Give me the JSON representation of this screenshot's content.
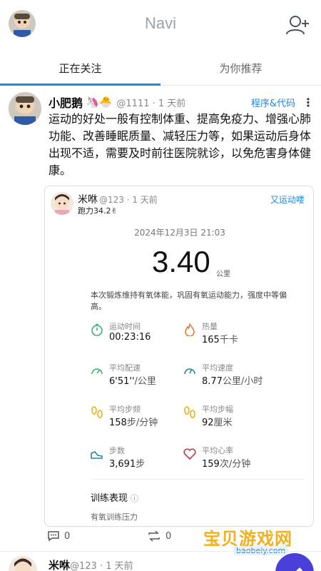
{
  "header": {
    "title": "Navi"
  },
  "tabs": [
    {
      "label": "正在关注",
      "active": true
    },
    {
      "label": "为你推荐",
      "active": false
    }
  ],
  "post": {
    "author": "小肥鹅",
    "emoji": "🦄🐣",
    "handle": "@1111 · 1 天前",
    "tag": "程序&代码",
    "more": "⋮",
    "text": "运动的好处一般有控制体重、提高免疫力、增强心肺功能、改善睡眠质量、减轻压力等，如果运动后身体出现不适，需要及时前往医院就诊，以免危害身体健康。"
  },
  "card": {
    "name": "米咻",
    "handle": "@123 · 1 天前",
    "sub": "跑力34.2✌",
    "tag": "又运动喽",
    "date": "2024年12月3日  21:03",
    "distance": "3.40",
    "unit": "公里",
    "desc": "本次锻炼维持有氧体能，巩固有氧运动能力，强度中等偏高。",
    "metrics": [
      {
        "label": "运动时间",
        "value": "00:23:16",
        "unit": "",
        "icon": "stopwatch-icon"
      },
      {
        "label": "热量",
        "value": "165",
        "unit": "千卡",
        "icon": "flame-icon"
      },
      {
        "label": "平均配速",
        "value": "6'51''",
        "unit": "/公里",
        "icon": "gauge-icon"
      },
      {
        "label": "平均速度",
        "value": "8.77",
        "unit": "公里/小时",
        "icon": "speedometer-icon"
      },
      {
        "label": "平均步频",
        "value": "158",
        "unit": "步/分钟",
        "icon": "footprints-icon"
      },
      {
        "label": "平均步幅",
        "value": "92",
        "unit": "厘米",
        "icon": "footprints-icon"
      },
      {
        "label": "步数",
        "value": "3,691",
        "unit": "步",
        "icon": "shoe-icon"
      },
      {
        "label": "平均心率",
        "value": "159",
        "unit": "次/分钟",
        "icon": "heart-icon"
      }
    ],
    "perf_title": "训练表现",
    "perf_info": "ⓘ",
    "perf_sub": "有氧训练压力"
  },
  "actions": {
    "comments": "0",
    "reposts": "0"
  },
  "watermark": {
    "title": "宝贝游戏网",
    "sub": "baobeiy.com"
  },
  "next_post": {
    "author": "米咻",
    "handle": "@123 · 1 天前"
  },
  "colors": {
    "accent": "#1e88e5",
    "icon_green": "#3cb371",
    "icon_orange": "#e07a3a",
    "icon_yellow": "#e8b11c",
    "icon_teal": "#2a8a8a",
    "icon_red": "#c0394a"
  }
}
